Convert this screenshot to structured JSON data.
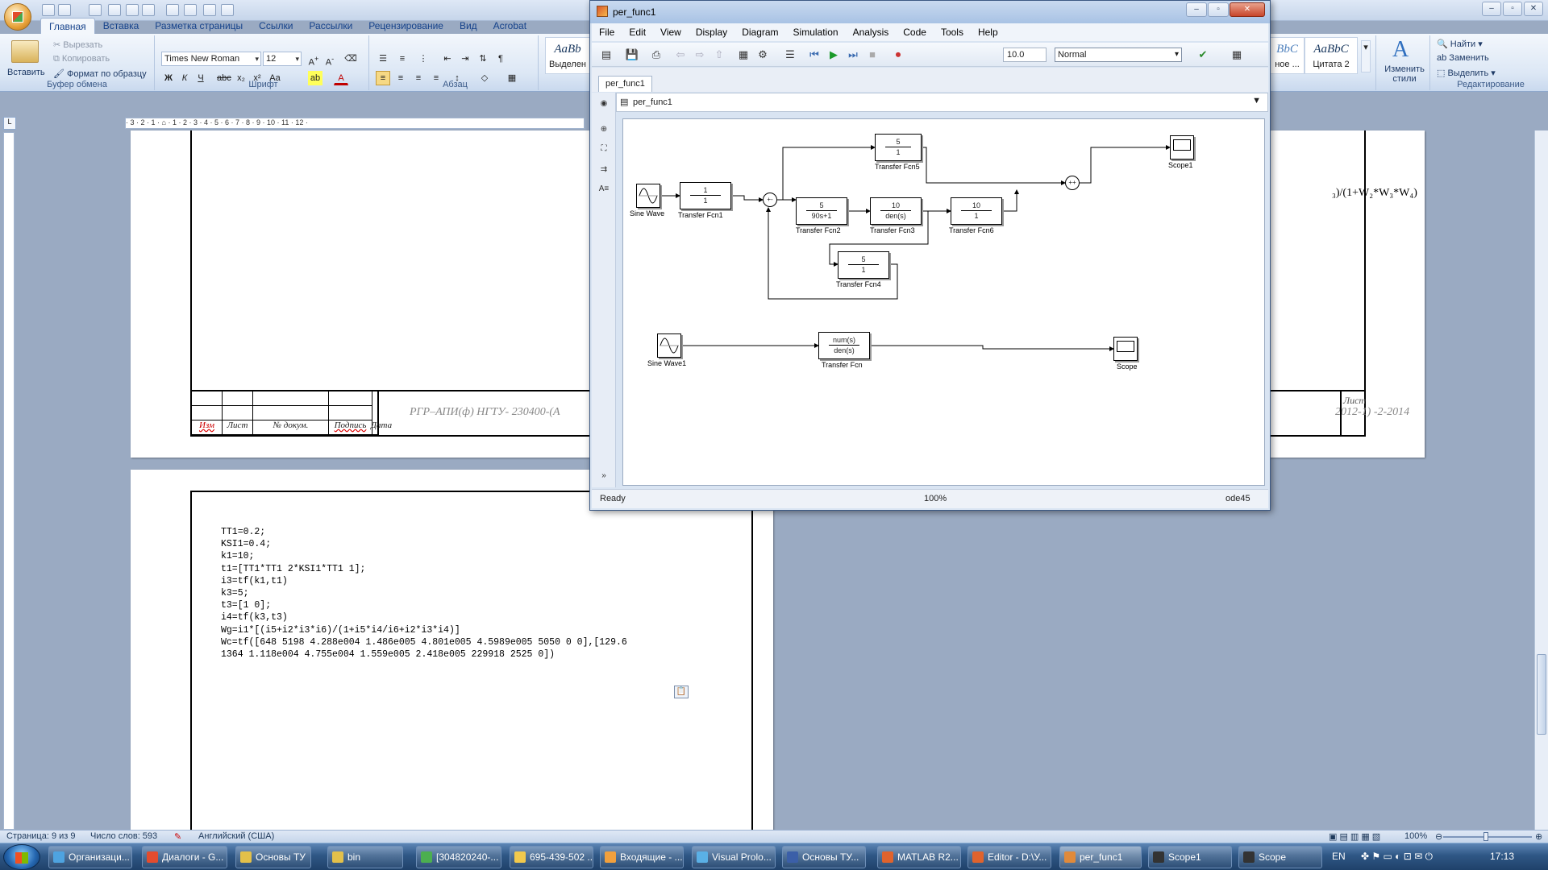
{
  "word": {
    "tabs": [
      "Главная",
      "Вставка",
      "Разметка страницы",
      "Ссылки",
      "Рассылки",
      "Рецензирование",
      "Вид",
      "Acrobat"
    ],
    "clipboard": {
      "paste": "Вставить",
      "cut": "Вырезать",
      "copy": "Копировать",
      "format_painter": "Формат по образцу",
      "group": "Буфер обмена"
    },
    "font": {
      "name": "Times New Roman",
      "size": "12",
      "group": "Шрифт"
    },
    "paragraph_group": "Абзац",
    "styles": [
      {
        "sample": "AaBb",
        "name": "Выделен"
      },
      {
        "sample": "AaBbC",
        "name": "Цитата 2"
      }
    ],
    "styles_partial": {
      "sample": "BbC",
      "name": "ное ..."
    },
    "change_styles": "Изменить стили",
    "editing": {
      "find": "Найти",
      "replace": "Заменить",
      "select": "Выделить",
      "group": "Редактирование"
    },
    "page1": {
      "stamp_headers": [
        "Изм",
        "Лист",
        "№ докум.",
        "Подпись",
        "Дата"
      ],
      "stamp_title": "РГР–АПИ(ф) НГТУ- 230400-(А",
      "stamp_title_right": "2012-1) -2-2014",
      "stamp_list": "Лист",
      "formula": "₃)/(1+W₂*W₃*W₄)"
    },
    "page2": {
      "code": "TT1=0.2;\nKSI1=0.4;\nk1=10;\nt1=[TT1*TT1 2*KSI1*TT1 1];\ni3=tf(k1,t1)\nk3=5;\nt3=[1 0];\ni4=tf(k3,t3)\nWg=i1*[(i5+i2*i3*i6)/(1+i5*i4/i6+i2*i3*i4)]\nWc=tf([648 5198 4.288e004 1.486e005 4.801e005 4.5989e005 5050 0 0],[129.6\n1364 1.118e004 4.755e004 1.559e005 2.418e005 229918 2525 0])"
    },
    "status": {
      "page": "Страница: 9 из 9",
      "words": "Число слов: 593",
      "language": "Английский (США)",
      "zoom": "100%"
    }
  },
  "simulink": {
    "title": "per_func1",
    "menu": [
      "File",
      "Edit",
      "View",
      "Display",
      "Diagram",
      "Simulation",
      "Analysis",
      "Code",
      "Tools",
      "Help"
    ],
    "stop_time": "10.0",
    "sim_mode": "Normal",
    "tab": "per_func1",
    "address": "per_func1",
    "status": {
      "state": "Ready",
      "zoom": "100%",
      "solver": "ode45"
    },
    "blocks": {
      "sine1": "Sine Wave",
      "tf1": {
        "num": "1",
        "den": "1",
        "label": "Transfer Fcn1"
      },
      "tf2": {
        "num": "5",
        "den": "90s+1",
        "label": "Transfer Fcn2"
      },
      "tf3": {
        "num": "10",
        "den": "den(s)",
        "label": "Transfer Fcn3"
      },
      "tf4": {
        "num": "5",
        "den": "1",
        "label": "Transfer Fcn4"
      },
      "tf5": {
        "num": "5",
        "den": "1",
        "label": "Transfer Fcn5"
      },
      "tf6": {
        "num": "10",
        "den": "1",
        "label": "Transfer Fcn6"
      },
      "scope1": "Scope1",
      "sine2": "Sine Wave1",
      "tf": {
        "num": "num(s)",
        "den": "den(s)",
        "label": "Transfer Fcn"
      },
      "scope": "Scope"
    }
  },
  "taskbar": {
    "items": [
      "Организаци...",
      "Диалоги - G...",
      "Основы ТУ",
      "bin",
      "[304820240-...",
      "695-439-502 ...",
      "Входящие - ...",
      "Visual Prolo...",
      "Основы ТУ...",
      "MATLAB R2...",
      "Editor - D:\\У...",
      "per_func1",
      "Scope1",
      "Scope"
    ],
    "lang": "EN",
    "time": "17:13"
  }
}
